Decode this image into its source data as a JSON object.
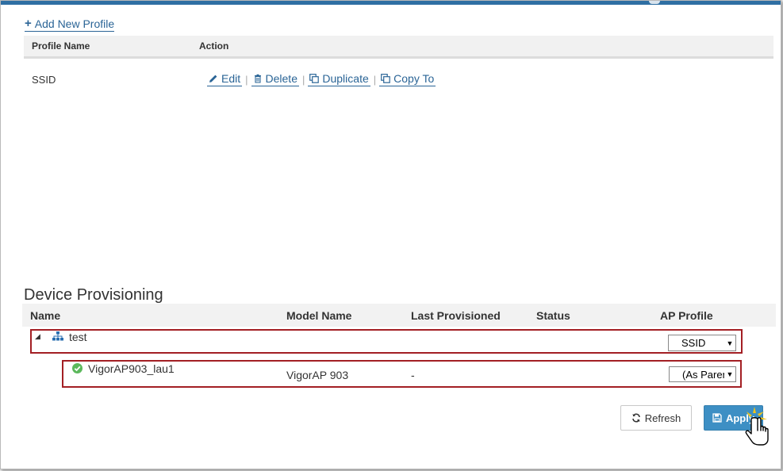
{
  "profiles": {
    "add_label": "Add New Profile",
    "columns": {
      "name": "Profile Name",
      "action": "Action"
    },
    "rows": [
      {
        "name": "SSID",
        "edit": "Edit",
        "delete": "Delete",
        "duplicate": "Duplicate",
        "copy_to": "Copy To"
      }
    ]
  },
  "provisioning": {
    "title": "Device Provisioning",
    "columns": {
      "name": "Name",
      "model": "Model Name",
      "last": "Last Provisioned",
      "status": "Status",
      "ap_profile": "AP Profile"
    },
    "group": {
      "name": "test",
      "ap_profile": "SSID"
    },
    "device": {
      "name": "VigorAP903_lau1",
      "model": "VigorAP 903",
      "last_provisioned": "-",
      "ap_profile": "(As Parent)"
    }
  },
  "buttons": {
    "refresh": "Refresh",
    "apply": "Apply"
  },
  "colors": {
    "accent": "#2f6fa3",
    "link": "#2a6496",
    "apply_bg": "#3d8fc4",
    "highlight_border": "#a31f24",
    "online": "#5cb85c"
  }
}
